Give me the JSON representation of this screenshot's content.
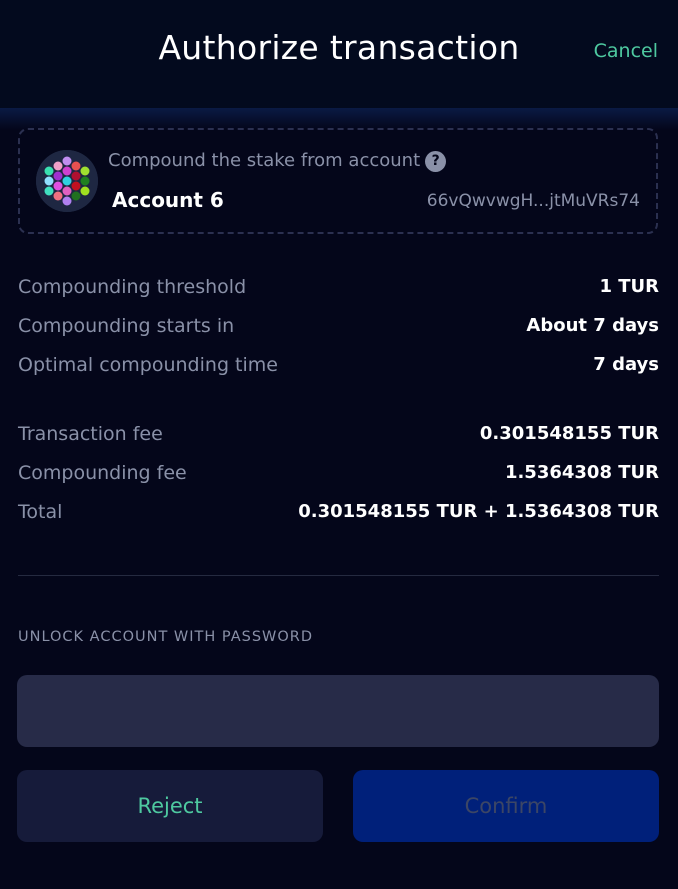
{
  "header": {
    "title": "Authorize transaction",
    "cancel_label": "Cancel"
  },
  "account": {
    "caption": "Compound the stake from account",
    "help_icon": "question-circle-icon",
    "help_glyph": "?",
    "name": "Account 6",
    "address": "66vQwvwgH...jtMuVRs74"
  },
  "details": [
    {
      "label": "Compounding threshold",
      "value": "1 TUR"
    },
    {
      "label": "Compounding starts in",
      "value": "About 7 days"
    },
    {
      "label": "Optimal compounding time",
      "value": "7 days"
    }
  ],
  "fees": [
    {
      "label": "Transaction fee",
      "value": "0.301548155 TUR"
    },
    {
      "label": "Compounding fee",
      "value": "1.5364308 TUR"
    },
    {
      "label": "Total",
      "value": "0.301548155 TUR + 1.5364308 TUR"
    }
  ],
  "password": {
    "label": "UNLOCK ACCOUNT WITH PASSWORD",
    "value": "",
    "placeholder": ""
  },
  "actions": {
    "reject_label": "Reject",
    "confirm_label": "Confirm"
  },
  "colors": {
    "background": "#04061a",
    "accent": "#4ec9a0",
    "muted_text": "#8a91a8",
    "input_bg": "#272b48",
    "reject_bg": "#161b3a",
    "confirm_bg": "#00207a"
  }
}
